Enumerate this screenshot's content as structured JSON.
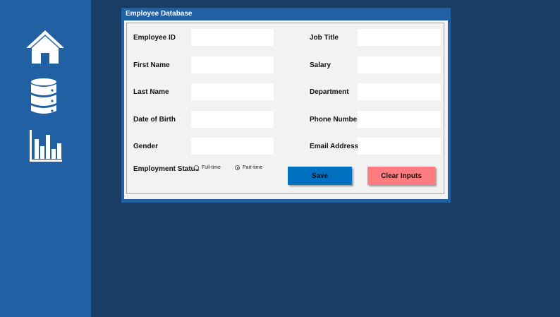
{
  "sidebar": {
    "items": [
      {
        "icon": "home-icon"
      },
      {
        "icon": "database-icon"
      },
      {
        "icon": "bar-chart-icon"
      }
    ],
    "colors": {
      "background": "#2160a3",
      "icon": "#ffffff"
    }
  },
  "form": {
    "title": "Employee Database",
    "fields": {
      "employee_id": {
        "label": "Employee ID",
        "value": ""
      },
      "first_name": {
        "label": "First Name",
        "value": ""
      },
      "last_name": {
        "label": "Last Name",
        "value": ""
      },
      "date_of_birth": {
        "label": "Date of Birth",
        "value": ""
      },
      "gender": {
        "label": "Gender",
        "value": ""
      },
      "job_title": {
        "label": "Job Title",
        "value": ""
      },
      "salary": {
        "label": "Salary",
        "value": ""
      },
      "department": {
        "label": "Department",
        "value": ""
      },
      "phone_number": {
        "label": "Phone Number",
        "value": ""
      },
      "email_address": {
        "label": "Email Address",
        "value": ""
      }
    },
    "employment_status": {
      "label": "Employment Status",
      "options": [
        "Full-time",
        "Part-time"
      ],
      "selected": "Part-time"
    },
    "buttons": {
      "save": {
        "label": "Save",
        "color": "#0070c0"
      },
      "clear": {
        "label": "Clear Inputs",
        "color": "#ff7c80"
      }
    }
  },
  "colors": {
    "background": "#1a3d66",
    "panel": "#f2f2f2"
  }
}
